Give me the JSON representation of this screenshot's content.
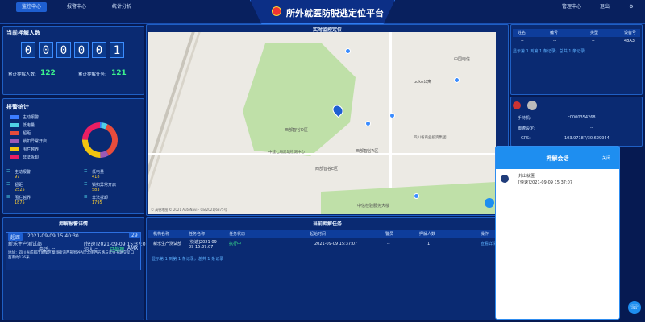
{
  "nav_left": [
    "监控中心",
    "报警中心",
    "统计分析"
  ],
  "nav_right": [
    "管理中心",
    "退出"
  ],
  "app_title": "所外就医防脱逃定位平台",
  "current_people": {
    "title": "当前押解人数",
    "digits": [
      "0",
      "0",
      "0",
      "0",
      "0",
      "1"
    ],
    "total_label": "累计押解人数:",
    "total_value": "122",
    "tasks_label": "累计押解任务:",
    "tasks_value": "121"
  },
  "alarm_stats": {
    "title": "报警统计",
    "legend": [
      {
        "label": "主动报警",
        "color": "#3c7dff"
      },
      {
        "label": "低电量",
        "color": "#4fd0e6"
      },
      {
        "label": "超距",
        "color": "#e74c3c"
      },
      {
        "label": "锁扣异常开启",
        "color": "#9b59b6"
      },
      {
        "label": "围栏越界",
        "color": "#f1c40f"
      },
      {
        "label": "非法拆卸",
        "color": "#e91e63"
      }
    ],
    "items": [
      {
        "label": "主动报警",
        "value": "97"
      },
      {
        "label": "低电量",
        "value": "418"
      },
      {
        "label": "超距",
        "value": "2525"
      },
      {
        "label": "锁扣异常开启",
        "value": "583"
      },
      {
        "label": "围栏越界",
        "value": "1875"
      },
      {
        "label": "非法拆卸",
        "value": "1795"
      }
    ]
  },
  "alarm_details": {
    "title": "押解报警详情",
    "tag": "超距",
    "time": "2021-09-09 15:40:30",
    "count": "29",
    "org": "新乐生产测试部",
    "start_label": "[快速]2021-09-09 15:37:07",
    "phone_label": "电话:",
    "phone_value": "--",
    "person_label": "犯人:",
    "person_value": "--",
    "status_label": "已处理",
    "addr_label": "AMX",
    "address": "地址：四川省成都市武侯区蜀翔街道西部智谷A区北侧西五路与武兴五路交叉口西南约136米"
  },
  "map": {
    "title": "实时监控定位",
    "labels": [
      "成都市武侯区",
      "西部智谷D区",
      "西部智谷A区",
      "中国电信",
      "uoko公寓",
      "中建七局建筑检测中心",
      "四川省商业投资集团",
      "西部智谷E区",
      "中信检验服务大楼"
    ],
    "footer": "© 高德地图 © 2021 AutoNavi - GS(2021)6375号"
  },
  "current_tasks": {
    "title": "当前押解任务",
    "headers": [
      "机构名称",
      "任务名称",
      "任务状态",
      "起始时间",
      "警员",
      "押解人数",
      "操作"
    ],
    "rows": [
      {
        "org": "新乐生产测试部",
        "task": "[快速]2021-09-09 15:37:07",
        "status": "执行中",
        "start": "2021-09-09 15:37:07",
        "police": "--",
        "count": "1",
        "action": "查看详情"
      }
    ],
    "pager": "显示第 1 到第 1 条记录，总共 1 条记录"
  },
  "device_table": {
    "headers": [
      "姓名",
      "编号",
      "类型",
      "设备号"
    ],
    "row": [
      "--",
      "--",
      "--",
      "48A3"
    ],
    "pager": "显示第 1 到第 1 条记录，总共 1 条记录"
  },
  "person_info": {
    "phone_label": "手持机:",
    "phone_value": "c0000354268",
    "bracelet_label": "脚镣设定:",
    "bracelet_value": "--",
    "gps_label": "GPS:",
    "gps_value": "103.97187/30.629944"
  },
  "modal": {
    "title": "押解会话",
    "close": "关闭",
    "sender": "外出就医",
    "message": "[快速]2021-09-09 15:37:07"
  },
  "colors": {
    "accent": "#1e8ef0",
    "bg": "#061a52",
    "panel": "#0a2a72"
  }
}
